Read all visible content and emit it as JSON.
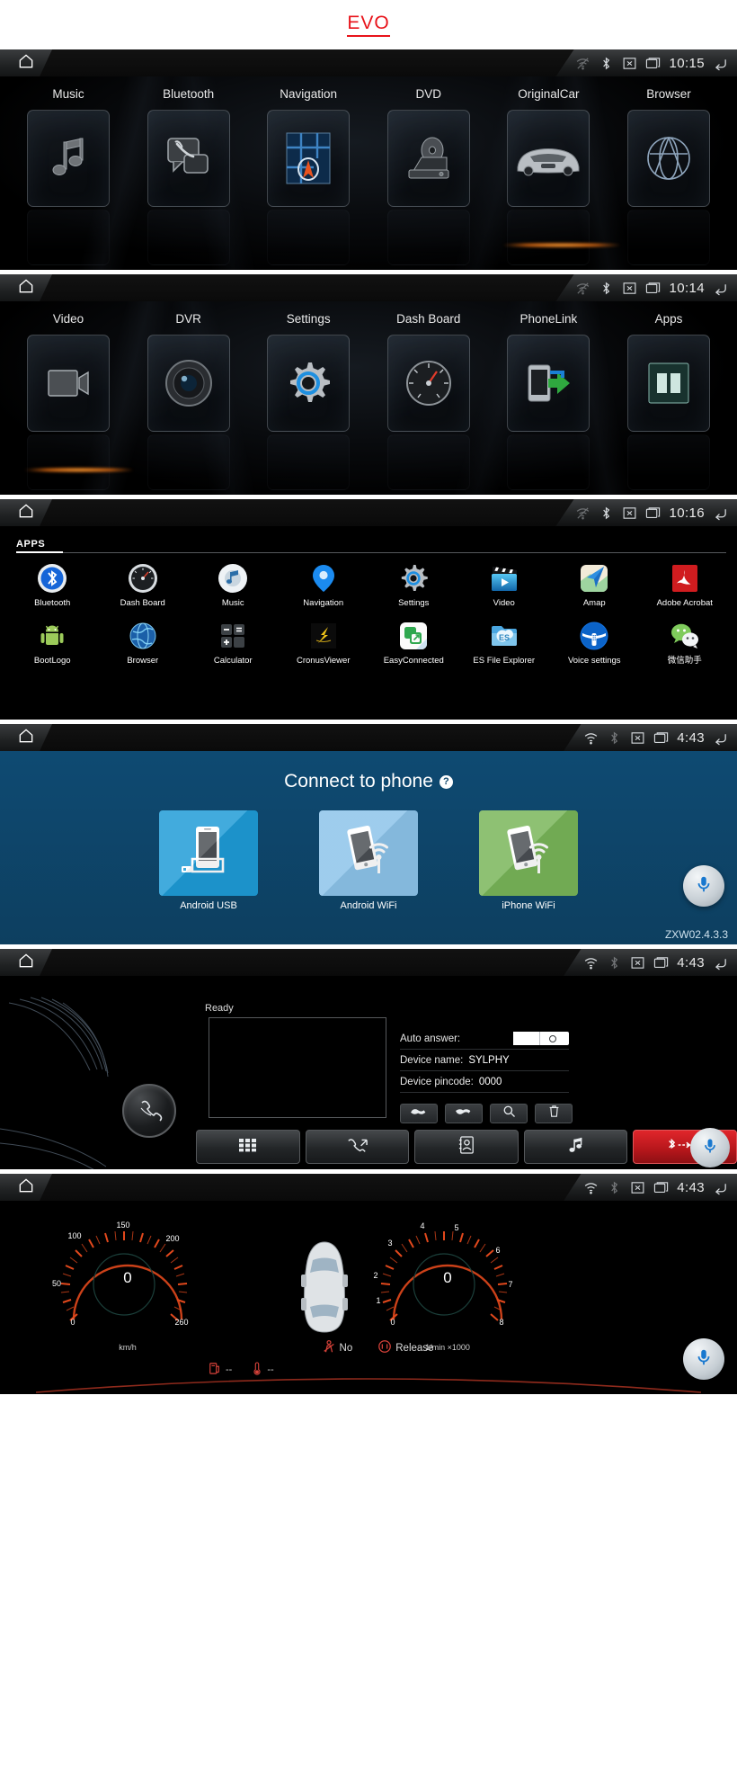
{
  "header": {
    "title": "EVO"
  },
  "statusbar": {
    "home_icon": "home-icon",
    "wifi_icon": "wifi-icon",
    "bluetooth_icon": "bluetooth-icon",
    "x_icon": "x-box-icon",
    "display_icon": "display-icon",
    "back_icon": "back-arrow-icon"
  },
  "screens": {
    "home1": {
      "time": "10:15",
      "tiles": [
        {
          "label": "Music",
          "icon": "music-note-icon"
        },
        {
          "label": "Bluetooth",
          "icon": "phone-handset-icon"
        },
        {
          "label": "Navigation",
          "icon": "map-arrow-icon"
        },
        {
          "label": "DVD",
          "icon": "disc-player-icon"
        },
        {
          "label": "OriginalCar",
          "icon": "car-icon"
        },
        {
          "label": "Browser",
          "icon": "globe-icon"
        }
      ]
    },
    "home2": {
      "time": "10:14",
      "tiles": [
        {
          "label": "Video",
          "icon": "video-camera-icon"
        },
        {
          "label": "DVR",
          "icon": "camera-lens-icon"
        },
        {
          "label": "Settings",
          "icon": "gear-icon"
        },
        {
          "label": "Dash Board",
          "icon": "speedometer-icon"
        },
        {
          "label": "PhoneLink",
          "icon": "phone-link-icon"
        },
        {
          "label": "Apps",
          "icon": "apps-grid-icon"
        }
      ]
    },
    "apps": {
      "time": "10:16",
      "tab_label": "APPS",
      "items": [
        {
          "label": "Bluetooth",
          "icon": "bluetooth-app-icon"
        },
        {
          "label": "Dash Board",
          "icon": "dashboard-app-icon"
        },
        {
          "label": "Music",
          "icon": "music-app-icon"
        },
        {
          "label": "Navigation",
          "icon": "map-pin-icon"
        },
        {
          "label": "Settings",
          "icon": "gear-app-icon"
        },
        {
          "label": "Video",
          "icon": "clapperboard-icon"
        },
        {
          "label": "Amap",
          "icon": "amap-icon"
        },
        {
          "label": "Adobe Acrobat",
          "icon": "adobe-acrobat-icon"
        },
        {
          "label": "BootLogo",
          "icon": "android-robot-icon"
        },
        {
          "label": "Browser",
          "icon": "globe-app-icon"
        },
        {
          "label": "Calculator",
          "icon": "calculator-icon"
        },
        {
          "label": "CronusViewer",
          "icon": "cronus-icon"
        },
        {
          "label": "EasyConnected",
          "icon": "easyconnected-icon"
        },
        {
          "label": "ES File Explorer",
          "icon": "es-file-explorer-icon"
        },
        {
          "label": "Voice settings",
          "icon": "steering-wheel-icon"
        },
        {
          "label": "微信助手",
          "icon": "wechat-icon"
        }
      ]
    },
    "phonelink": {
      "time": "4:43",
      "title": "Connect to phone",
      "help_glyph": "?",
      "version": "ZXW02.4.3.3",
      "mic_icon": "microphone-icon",
      "tiles": [
        {
          "label": "Android USB",
          "icon": "phone-usb-icon",
          "color": "#1e9bd7"
        },
        {
          "label": "Android WiFi",
          "icon": "phone-wifi-icon",
          "color": "#8cc3ea"
        },
        {
          "label": "iPhone WiFi",
          "icon": "iphone-wifi-icon",
          "color": "#78b558"
        }
      ]
    },
    "bluetooth": {
      "time": "4:43",
      "status": "Ready",
      "fields": [
        {
          "key": "Auto answer:",
          "value": "",
          "type": "toggle"
        },
        {
          "key": "Device name:",
          "value": "SYLPHY",
          "type": "text"
        },
        {
          "key": "Device pincode:",
          "value": "0000",
          "type": "text"
        }
      ],
      "actions": [
        {
          "icon": "call-answer-icon"
        },
        {
          "icon": "call-end-icon"
        },
        {
          "icon": "search-icon"
        },
        {
          "icon": "trash-icon"
        }
      ],
      "bottom_buttons": [
        {
          "icon": "keypad-icon"
        },
        {
          "icon": "call-log-icon"
        },
        {
          "icon": "contacts-icon"
        },
        {
          "icon": "music-note-icon"
        },
        {
          "icon": "bluetooth-disconnect-icon"
        }
      ],
      "mic_icon": "microphone-icon"
    },
    "dashboard": {
      "time": "4:43",
      "mic_icon": "microphone-icon",
      "indicators": [
        {
          "icon": "seatbelt-icon",
          "label": "No"
        },
        {
          "icon": "handbrake-icon",
          "label": "Release"
        }
      ],
      "meters": [
        {
          "icon": "fuel-icon",
          "label": "--"
        },
        {
          "icon": "temperature-icon",
          "label": "--"
        }
      ]
    }
  },
  "chart_data": [
    {
      "type": "gauge",
      "title": "Speedometer",
      "value": 0,
      "unit": "km/h",
      "ylabel": "km/h",
      "min": 0,
      "max": 260,
      "ticks": [
        0,
        50,
        100,
        150,
        200,
        260
      ],
      "tick_labels": [
        "0",
        "50",
        "100",
        "150",
        "200",
        "260"
      ],
      "accent": "#e2481c"
    },
    {
      "type": "gauge",
      "title": "Tachometer",
      "value": 0,
      "unit": "1/min ×1000",
      "ylabel": "1/min ×1000",
      "min": 0,
      "max": 8,
      "ticks": [
        0,
        1,
        2,
        3,
        4,
        5,
        6,
        7,
        8
      ],
      "tick_labels": [
        "0",
        "1",
        "2",
        "3",
        "4",
        "5",
        "6",
        "7",
        "8"
      ],
      "accent": "#e2481c"
    }
  ]
}
